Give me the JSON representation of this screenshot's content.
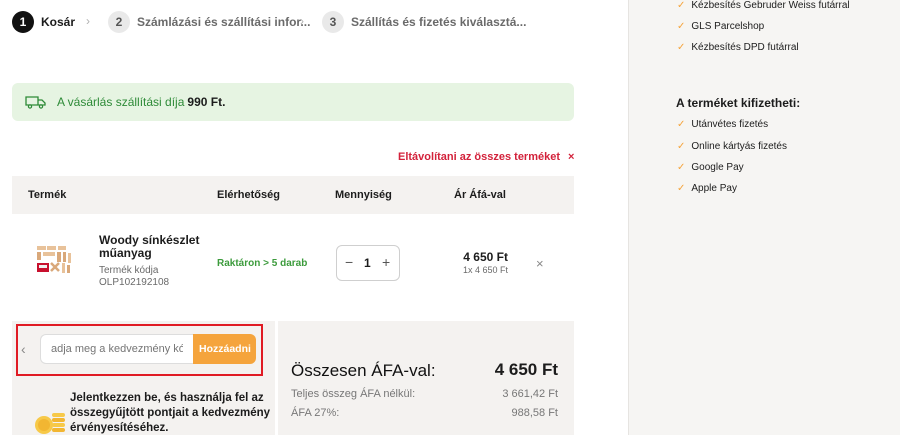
{
  "steps": [
    {
      "number": "1",
      "label": "Kosár"
    },
    {
      "number": "2",
      "label": "Számlázási és szállítási infor..."
    },
    {
      "number": "3",
      "label": "Szállítás és fizetés kiválasztá..."
    }
  ],
  "shipping_banner": {
    "text": "A vásárlás szállítási díja",
    "amount": "990 Ft."
  },
  "remove_all": {
    "label": "Eltávolítani az összes terméket",
    "icon": "×"
  },
  "table_headers": {
    "product": "Termék",
    "availability": "Elérhetőség",
    "quantity": "Mennyiség",
    "price": "Ár Áfá-val"
  },
  "product": {
    "name": "Woody sínkészlet műanyag",
    "code_label": "Termék kódja",
    "code": "OLP102192108",
    "availability": "Raktáron > 5 darab",
    "quantity": "1",
    "price": "4 650 Ft",
    "unit_price": "1x 4 650 Ft",
    "remove_icon": "×"
  },
  "quantity_controls": {
    "minus": "−",
    "plus": "+"
  },
  "coupon": {
    "placeholder": "adja meg a kedvezmény kó",
    "button": "Hozzáadni",
    "back_icon": "‹"
  },
  "loyalty": {
    "text": "Jelentkezzen be, és használja fel az összegyűjtött pontjait a kedvezmény érvényesítéséhez."
  },
  "summary": {
    "total_label": "Összesen ÁFA-val:",
    "total_value": "4 650 Ft",
    "net_label": "Teljes összeg ÁFA nélkül:",
    "net_value": "3 661,42 Ft",
    "vat_label": "ÁFA 27%:",
    "vat_value": "988,58 Ft"
  },
  "delivery_options": [
    "Kézbesítés Gebruder Weiss futárral",
    "GLS Parcelshop",
    "Kézbesítés DPD futárral"
  ],
  "payment_heading": "A terméket kifizetheti:",
  "payment_options": [
    "Utánvétes fizetés",
    "Online kártyás fizetés",
    "Google Pay",
    "Apple Pay"
  ],
  "colors": {
    "accent": "#f5a43c",
    "danger": "#d3223b",
    "success": "#3c9b3c",
    "banner_bg": "#e6f4e2",
    "highlight": "#e01b24"
  }
}
